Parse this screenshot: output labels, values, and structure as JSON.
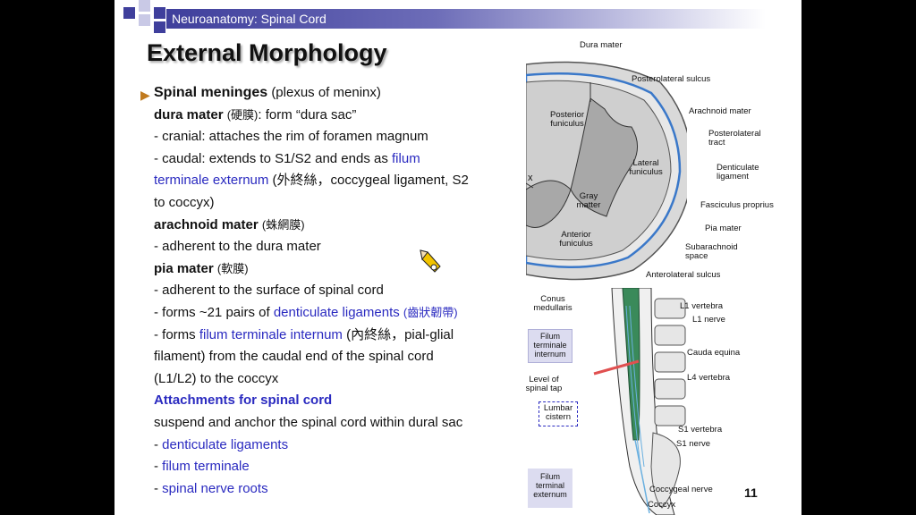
{
  "header": {
    "title": "Neuroanatomy: Spinal Cord"
  },
  "title": "External Morphology",
  "content": {
    "line1": {
      "heading": "Spinal meninges",
      "note": "(plexus of meninx)"
    },
    "dura": {
      "term": "dura mater",
      "chinese": "(硬膜)",
      "desc": ": form “dura sac”"
    },
    "dura_cranial": "- cranial: attaches the rim of foramen magnum",
    "dura_caudal_a": "- caudal: extends to S1/S2 and ends as ",
    "dura_caudal_link": "filum",
    "dura_caudal_link2": "terminale externum",
    "dura_caudal_b": " (外終絲，coccygeal ligament, S2",
    "dura_caudal_c": "to coccyx)",
    "arachnoid": {
      "term": "arachnoid mater",
      "chinese": "(蛛網膜)"
    },
    "arachnoid_desc": "- adherent to the dura mater",
    "pia": {
      "term": "pia mater",
      "chinese": "(軟膜)"
    },
    "pia_desc1": "- adherent to the surface of spinal cord",
    "pia_desc2_a": "- forms ~21 pairs of ",
    "pia_desc2_link": "denticulate ligaments",
    "pia_desc2_chinese": "(齒狀韌帶)",
    "pia_desc3_a": "- forms ",
    "pia_desc3_link": "filum terminale internum",
    "pia_desc3_b": " (內終絲，pial-glial",
    "pia_desc3_c": "filament) from the caudal end of the spinal cord",
    "pia_desc3_d": "(L1/L2) to the coccyx",
    "attachments_heading": "Attachments for spinal cord",
    "attachments_desc": "suspend and anchor the spinal cord within dural sac",
    "attachments": [
      "denticulate ligaments",
      "filum terminale",
      "spinal nerve roots"
    ]
  },
  "cross_section_labels": {
    "dura_mater": "Dura mater",
    "posterolateral_sulcus": "Posterolateral sulcus",
    "arachnoid_mater": "Arachnoid mater",
    "posterior_funiculus": "Posterior funiculus",
    "posterolateral_tract": "Posterolateral tract",
    "lateral_funiculus": "Lateral funiculus",
    "denticulate_ligament": "Denticulate ligament",
    "gray_matter": "Gray matter",
    "fasciculus_proprius": "Fasciculus proprius",
    "pia_mater": "Pia mater",
    "anterior_funiculus": "Anterior funiculus",
    "subarachnoid_space": "Subarachnoid space",
    "anterolateral_sulcus": "Anterolateral sulcus",
    "x_mark": "x"
  },
  "sagittal_labels": {
    "conus_medullaris": "Conus medullaris",
    "l1_vertebra": "L1 vertebra",
    "l1_nerve": "L1 nerve",
    "filum_terminale_internum": "Filum terminale internum",
    "cauda_equina": "Cauda equina",
    "level_of_spinal_tap": "Level of spinal tap",
    "l4_vertebra": "L4 vertebra",
    "lumbar_cistern": "Lumbar cistern",
    "s1_vertebra": "S1 vertebra",
    "s1_nerve": "S1 nerve",
    "filum_terminale_externum": "Filum terminal externum",
    "coccygeal_nerve": "Coccygeal nerve",
    "coccyx": "Coccyx"
  },
  "page_number": "11",
  "colors": {
    "accent_blue": "#2a2ac0",
    "header_bar": "#3f3f9c",
    "box_fill": "#dcdcf0"
  }
}
